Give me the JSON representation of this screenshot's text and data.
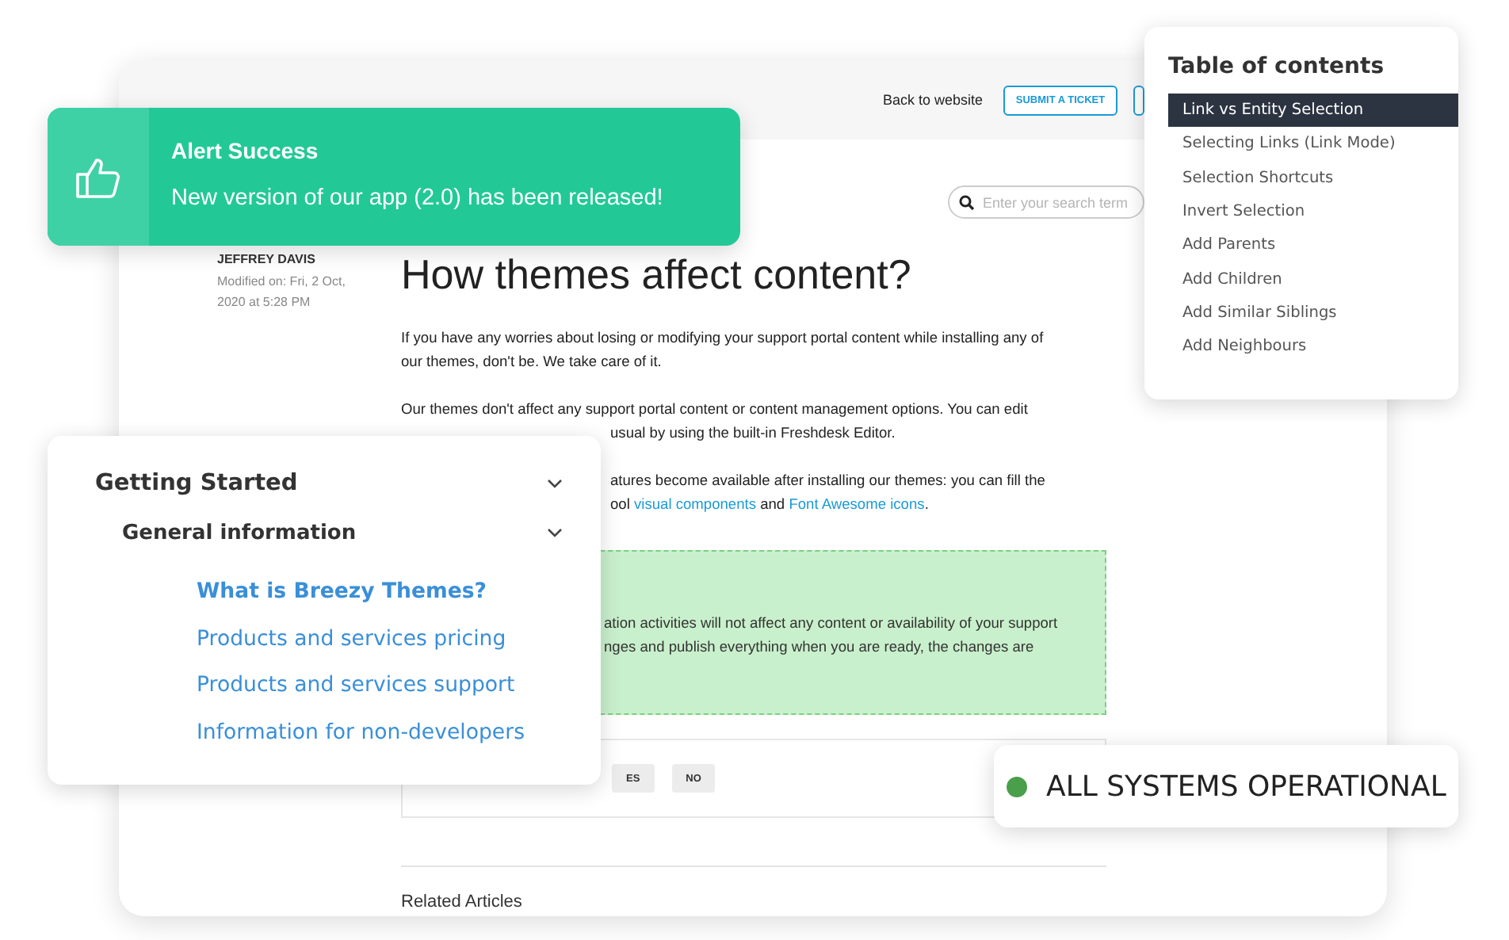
{
  "window": {
    "header": {
      "link": "Back to website",
      "buttons": [
        {
          "label": "SUBMIT A TICKET",
          "partial": false
        },
        {
          "partial": true
        }
      ]
    },
    "search": {
      "placeholder": "Enter your search term"
    },
    "author": {
      "name": "JEFFREY DAVIS",
      "modified": "Modified on: Fri, 2 Oct, 2020 at 5:28 PM"
    },
    "article": {
      "title": "How themes affect content?",
      "paragraphs": [
        {
          "lines": [
            {
              "partial": false,
              "segments": [
                {
                  "kind": "text",
                  "text": "If you have any worries about losing or modifying your support portal content while installing any of"
                }
              ]
            },
            {
              "partial": false,
              "segments": [
                {
                  "kind": "text",
                  "text": "our themes, don't be. We take care of it."
                }
              ]
            }
          ]
        },
        {
          "lines": [
            {
              "partial": false,
              "segments": [
                {
                  "kind": "text",
                  "text": "Our themes don't affect any support portal content or content management options. You can edit"
                }
              ]
            },
            {
              "partial": true,
              "segments": [
                {
                  "kind": "text",
                  "text": "usual by using the built-in Freshdesk Editor."
                }
              ]
            }
          ]
        },
        {
          "lines": [
            {
              "partial": true,
              "segments": [
                {
                  "kind": "text",
                  "text": "atures become available after installing our themes: you can fill the"
                }
              ]
            },
            {
              "partial": true,
              "segments": [
                {
                  "kind": "text",
                  "text": "ool "
                },
                {
                  "kind": "link",
                  "text": "visual components"
                },
                {
                  "kind": "text",
                  "text": " and "
                },
                {
                  "kind": "link",
                  "text": "Font Awesome icons"
                },
                {
                  "kind": "text",
                  "text": "."
                }
              ]
            }
          ]
        }
      ],
      "callout": {
        "lines": [
          "ation activities will not affect any content or availability of your support",
          "nges and publish everything when you are ready, the changes are"
        ]
      },
      "feedback": {
        "buttons": [
          {
            "label": "ES"
          },
          {
            "label": "NO"
          }
        ]
      },
      "related": "Related Articles"
    }
  },
  "alert": {
    "title": "Alert Success",
    "message": "New version of our app (2.0) has been released!"
  },
  "toc": {
    "title": "Table of contents",
    "items": [
      {
        "label": "Link vs Entity Selection",
        "selected": true
      },
      {
        "label": "Selecting Links (Link Mode)",
        "selected": false
      },
      {
        "label": "Selection Shortcuts",
        "selected": false
      },
      {
        "label": "Invert Selection",
        "selected": false
      },
      {
        "label": "Add Parents",
        "selected": false
      },
      {
        "label": "Add Children",
        "selected": false
      },
      {
        "label": "Add Similar Siblings",
        "selected": false
      },
      {
        "label": "Add Neighbours",
        "selected": false
      }
    ]
  },
  "navigation": {
    "sections": [
      {
        "label": "Getting Started",
        "expanded": true,
        "children": [
          {
            "label": "General information",
            "expanded": true,
            "children": [
              {
                "label": "What is Breezy Themes?",
                "selected": true
              },
              {
                "label": "Products and services pricing",
                "selected": false
              },
              {
                "label": "Products and services support",
                "selected": false
              },
              {
                "label": "Information for non-developers",
                "selected": false
              }
            ]
          }
        ]
      }
    ]
  },
  "status": {
    "label": "ALL SYSTEMS OPERATIONAL",
    "color": "#4a9f4a"
  }
}
